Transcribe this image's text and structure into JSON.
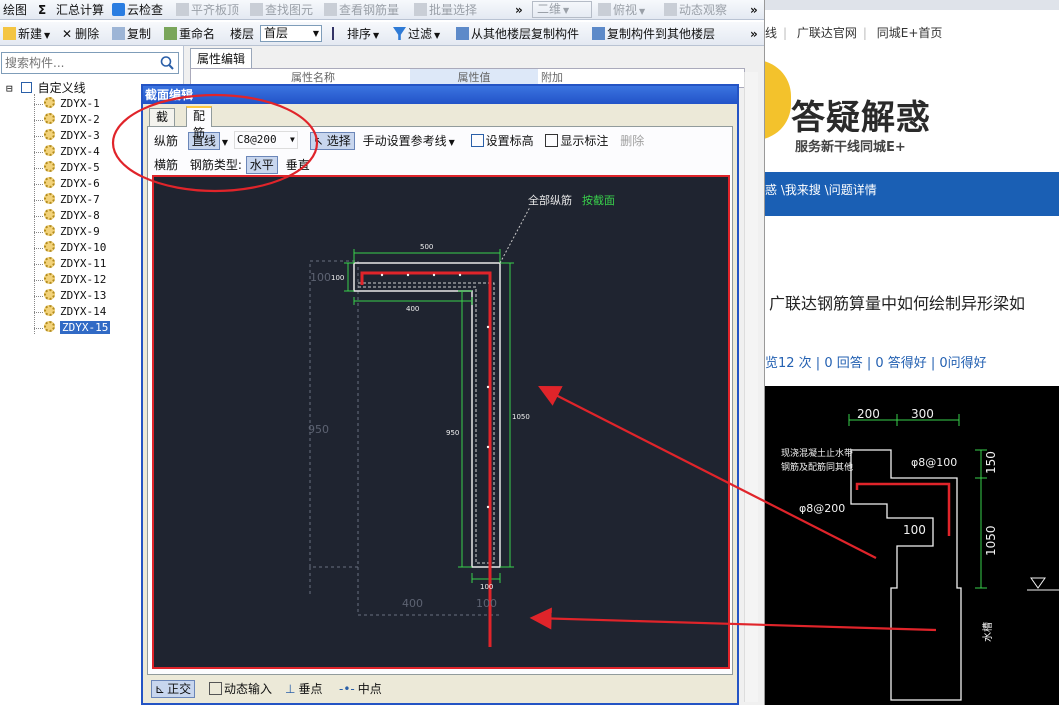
{
  "toolbar1": {
    "draw": "绘图",
    "sum_icon": "Σ",
    "summary": "汇总计算",
    "cloud_check": "云检查",
    "flush_top": "平齐板顶",
    "find_element": "查找图元",
    "view_rebar": "查看钢筋量",
    "batch_select": "批量选择",
    "more": "»",
    "view_mode": "二维",
    "view_angle": "俯视",
    "dynamic_view": "动态观察",
    "more2": "»"
  },
  "toolbar2": {
    "new": "新建",
    "delete": "删除",
    "copy": "复制",
    "rename": "重命名",
    "floor_label": "楼层",
    "floor_value": "首层",
    "sort": "排序",
    "filter": "过滤",
    "copy_from_floor": "从其他楼层复制构件",
    "copy_to_floor": "复制构件到其他楼层",
    "more": "»"
  },
  "search": {
    "placeholder": "搜索构件..."
  },
  "tree": {
    "root": "自定义线",
    "toggle": "⊟",
    "items": [
      "ZDYX-1",
      "ZDYX-2",
      "ZDYX-3",
      "ZDYX-4",
      "ZDYX-5",
      "ZDYX-6",
      "ZDYX-7",
      "ZDYX-8",
      "ZDYX-9",
      "ZDYX-10",
      "ZDYX-11",
      "ZDYX-12",
      "ZDYX-13",
      "ZDYX-14",
      "ZDYX-15"
    ],
    "selected_index": 14
  },
  "props": {
    "tab": "属性编辑",
    "col_name": "属性名称",
    "col_value": "属性值",
    "col_extra": "附加"
  },
  "dialog": {
    "title": "截面编辑",
    "tabs": [
      "截面",
      "配筋"
    ],
    "active_tab": 1,
    "row1": {
      "long_rebar": "纵筋",
      "line_mode": "直线",
      "rebar_spec": "C8@200",
      "select": "选择",
      "set_ref_line": "手动设置参考线",
      "set_elevation": "设置标高",
      "show_annotation": "显示标注",
      "delete": "删除"
    },
    "row2": {
      "stirrup": "横筋",
      "rebar_type_label": "钢筋类型:",
      "horizontal": "水平",
      "vertical": "垂直"
    },
    "canvas": {
      "label_all": "全部纵筋",
      "label_by_section": "按截面",
      "dims": [
        "500",
        "100",
        "400",
        "950",
        "1050",
        "100",
        "400",
        "100",
        "950",
        "100"
      ]
    },
    "bottom": {
      "ortho": "正交",
      "dynamic_input": "动态输入",
      "perp": "垂点",
      "mid": "中点"
    }
  },
  "web": {
    "links": [
      "线",
      "广联达官网",
      "同城E+首页"
    ],
    "logo_text": "答疑解惑",
    "logo_sub": "服务新干线同城E+",
    "nav": "惑 \\我来搜 \\问题详情",
    "question_title": "广联达钢筋算量中如何绘制异形梁如",
    "stats": "览12 次 | 0 回答 | 0 答得好 | 0问得好",
    "drawing": {
      "dims": [
        "200",
        "300",
        "150",
        "1050",
        "100"
      ],
      "labels": [
        "φ8@100",
        "φ8@200",
        "现浇混凝土止水带",
        "钢筋及配筋同其他",
        "水槽"
      ]
    }
  },
  "colors": {
    "annotation_red": "#e0242a",
    "canvas_bg": "#1f2430",
    "dim_green": "#39d14b",
    "rebar_red": "#e0242a",
    "nav_blue": "#1a5fb4",
    "selection_blue": "#316ac5"
  },
  "icons": {
    "sum": "sigma-icon",
    "cloud": "cloud-check-icon",
    "search": "magnifier-icon",
    "gear": "component-gear-icon"
  }
}
